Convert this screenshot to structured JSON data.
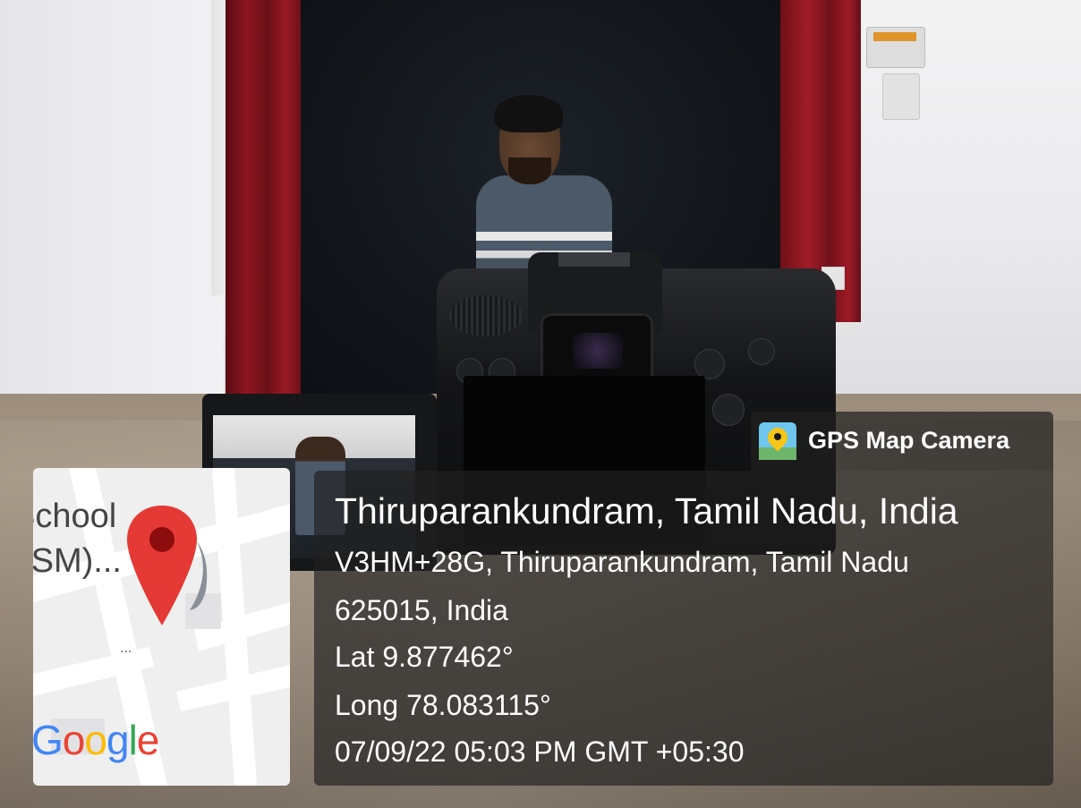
{
  "photo": {
    "subject": "person seated behind a DSLR camera with flip-out screen",
    "map_labels": [
      "School",
      "(SM)..."
    ],
    "map_ellipsis": "...",
    "map_provider": "Google",
    "colors": {
      "pin": "#e53935",
      "overlay": "#202020"
    }
  },
  "overlay": {
    "app_name": "GPS Map Camera",
    "location_title": "Thiruparankundram, Tamil Nadu, India",
    "address_line1": "V3HM+28G, Thiruparankundram, Tamil Nadu",
    "address_line2": "625015, India",
    "latitude": "Lat 9.877462°",
    "longitude": "Long 78.083115°",
    "datetime": "07/09/22 05:03 PM GMT +05:30"
  },
  "icons": {
    "app_icon": "gps-map-camera-icon",
    "map_pin": "map-pin-icon"
  }
}
